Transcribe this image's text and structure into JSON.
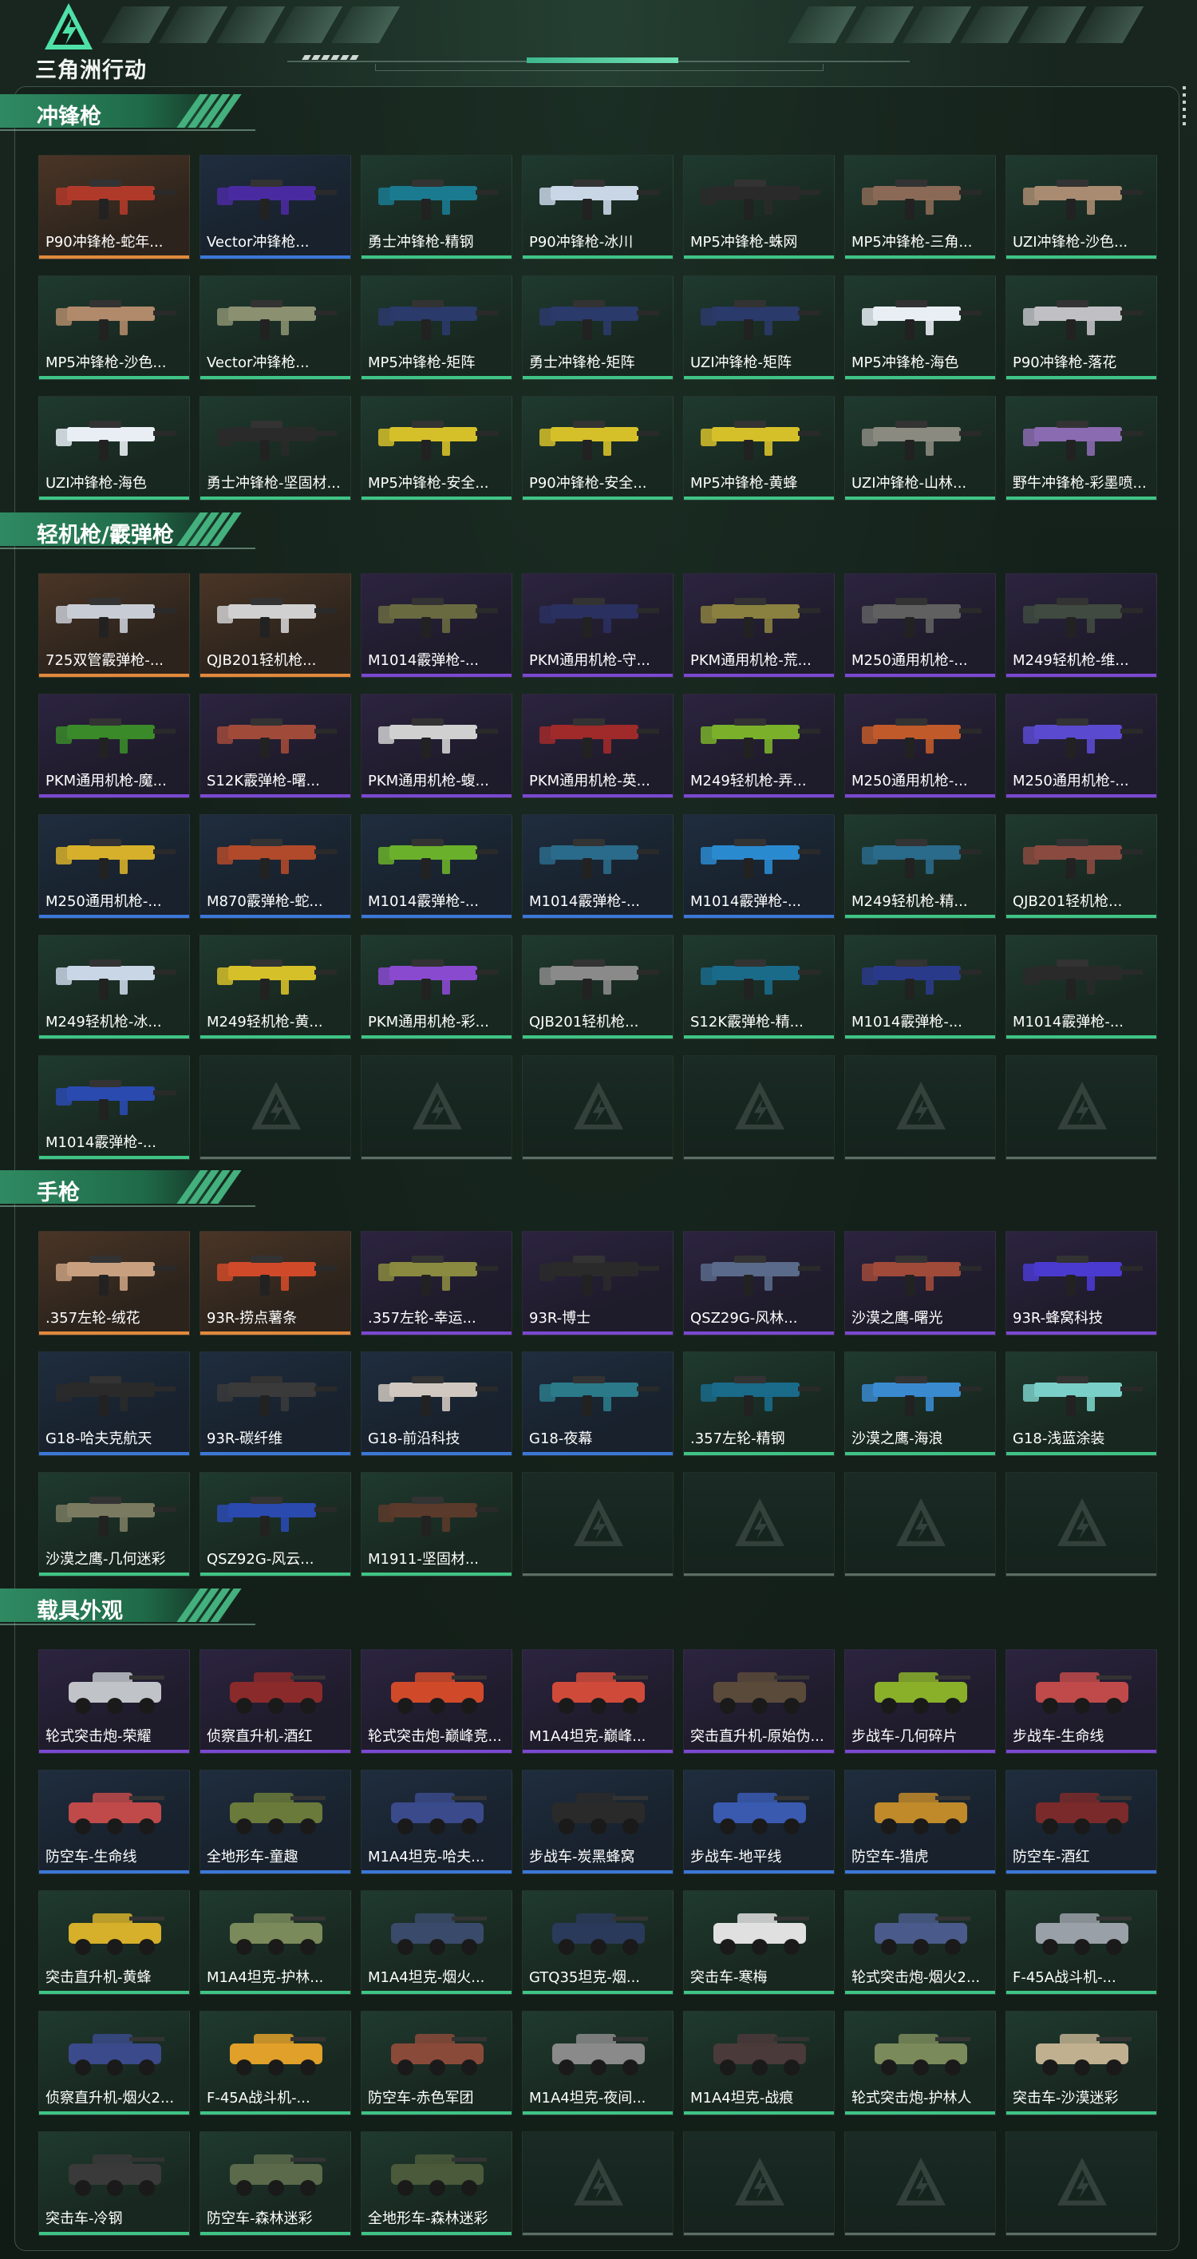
{
  "header": {
    "logo_text": "三角洲行动",
    "brand_color": "#3fc486"
  },
  "icons": {
    "logo": "delta-triangle-logo-icon",
    "item_art": "item-image-icon",
    "empty_slot": "empty-slot-icon"
  },
  "rarity_colors": {
    "gold": "#e08a3c",
    "purple": "#7a49d0",
    "blue": "#3b78d6",
    "green": "#3fc486"
  },
  "sections": [
    {
      "title": "冲锋枪",
      "items": [
        {
          "label": "P90冲锋枪-蛇年...",
          "rarity": "gold",
          "color": "#b03a2a"
        },
        {
          "label": "Vector冲锋枪...",
          "rarity": "blue",
          "color": "#4a2aa0"
        },
        {
          "label": "勇士冲锋枪-精钢",
          "rarity": "green",
          "color": "#1a7a90"
        },
        {
          "label": "P90冲锋枪-冰川",
          "rarity": "green",
          "color": "#c9d6e6"
        },
        {
          "label": "MP5冲锋枪-蛛网",
          "rarity": "green",
          "color": "#2a2a2a"
        },
        {
          "label": "MP5冲锋枪-三角...",
          "rarity": "green",
          "color": "#8a6a56"
        },
        {
          "label": "UZI冲锋枪-沙色...",
          "rarity": "green",
          "color": "#a88b70"
        },
        {
          "label": "MP5冲锋枪-沙色...",
          "rarity": "green",
          "color": "#b08a6a"
        },
        {
          "label": "Vector冲锋枪...",
          "rarity": "green",
          "color": "#8a9070"
        },
        {
          "label": "MP5冲锋枪-矩阵",
          "rarity": "green",
          "color": "#2a3a6a"
        },
        {
          "label": "勇士冲锋枪-矩阵",
          "rarity": "green",
          "color": "#2a3a6a"
        },
        {
          "label": "UZI冲锋枪-矩阵",
          "rarity": "green",
          "color": "#2a3a6a"
        },
        {
          "label": "MP5冲锋枪-海色",
          "rarity": "green",
          "color": "#e8eef4"
        },
        {
          "label": "P90冲锋枪-落花",
          "rarity": "green",
          "color": "#c0c0c4"
        },
        {
          "label": "UZI冲锋枪-海色",
          "rarity": "green",
          "color": "#e8eef4"
        },
        {
          "label": "勇士冲锋枪-坚固材...",
          "rarity": "green",
          "color": "#2a2a2a"
        },
        {
          "label": "MP5冲锋枪-安全...",
          "rarity": "green",
          "color": "#d6c02a"
        },
        {
          "label": "P90冲锋枪-安全...",
          "rarity": "green",
          "color": "#d6c02a"
        },
        {
          "label": "MP5冲锋枪-黄蜂",
          "rarity": "green",
          "color": "#d6c02a"
        },
        {
          "label": "UZI冲锋枪-山林...",
          "rarity": "green",
          "color": "#8a8a80"
        },
        {
          "label": "野牛冲锋枪-彩墨喷...",
          "rarity": "green",
          "color": "#8a6ab0"
        }
      ],
      "empty_slots": 0
    },
    {
      "title": "轻机枪/霰弹枪",
      "items": [
        {
          "label": "725双管霰弹枪-...",
          "rarity": "gold",
          "color": "#c8ccd4"
        },
        {
          "label": "QJB201轻机枪...",
          "rarity": "gold",
          "color": "#d0d0d0"
        },
        {
          "label": "M1014霰弹枪-...",
          "rarity": "purple",
          "color": "#6a6a40"
        },
        {
          "label": "PKM通用机枪-守...",
          "rarity": "purple",
          "color": "#2a3060"
        },
        {
          "label": "PKM通用机枪-荒...",
          "rarity": "purple",
          "color": "#8a8040"
        },
        {
          "label": "M250通用机枪-...",
          "rarity": "purple",
          "color": "#606060"
        },
        {
          "label": "M249轻机枪-维...",
          "rarity": "purple",
          "color": "#404a40"
        },
        {
          "label": "PKM通用机枪-魔...",
          "rarity": "purple",
          "color": "#3a8a2a"
        },
        {
          "label": "S12K霰弹枪-曙...",
          "rarity": "purple",
          "color": "#a04a3a"
        },
        {
          "label": "PKM通用机枪-蝮...",
          "rarity": "purple",
          "color": "#d0d0d0"
        },
        {
          "label": "PKM通用机枪-英...",
          "rarity": "purple",
          "color": "#a02a2a"
        },
        {
          "label": "M249轻机枪-弄...",
          "rarity": "purple",
          "color": "#7ab02a"
        },
        {
          "label": "M250通用机枪-...",
          "rarity": "purple",
          "color": "#c05a2a"
        },
        {
          "label": "M250通用机枪-...",
          "rarity": "purple",
          "color": "#5a4ad0"
        },
        {
          "label": "M250通用机枪-...",
          "rarity": "blue",
          "color": "#d6b02a"
        },
        {
          "label": "M870霰弹枪-蛇...",
          "rarity": "blue",
          "color": "#b04a2a"
        },
        {
          "label": "M1014霰弹枪-...",
          "rarity": "blue",
          "color": "#6ab02a"
        },
        {
          "label": "M1014霰弹枪-...",
          "rarity": "blue",
          "color": "#2a6a8a"
        },
        {
          "label": "M1014霰弹枪-...",
          "rarity": "blue",
          "color": "#2a8ad0"
        },
        {
          "label": "M249轻机枪-精...",
          "rarity": "green",
          "color": "#2a6a8a"
        },
        {
          "label": "QJB201轻机枪...",
          "rarity": "green",
          "color": "#8a4a40"
        },
        {
          "label": "M249轻机枪-冰...",
          "rarity": "green",
          "color": "#c9d6e6"
        },
        {
          "label": "M249轻机枪-黄...",
          "rarity": "green",
          "color": "#d6c02a"
        },
        {
          "label": "PKM通用机枪-彩...",
          "rarity": "green",
          "color": "#8a4ad0"
        },
        {
          "label": "QJB201轻机枪...",
          "rarity": "green",
          "color": "#8a8a8a"
        },
        {
          "label": "S12K霰弹枪-精...",
          "rarity": "green",
          "color": "#1a6a8a"
        },
        {
          "label": "M1014霰弹枪-...",
          "rarity": "green",
          "color": "#2a3a8a"
        },
        {
          "label": "M1014霰弹枪-...",
          "rarity": "green",
          "color": "#2a2a2a"
        },
        {
          "label": "M1014霰弹枪-...",
          "rarity": "green",
          "color": "#2a4ab0"
        }
      ],
      "empty_slots": 6
    },
    {
      "title": "手枪",
      "items": [
        {
          "label": ".357左轮-绒花",
          "rarity": "gold",
          "color": "#c8a080"
        },
        {
          "label": "93R-捞点薯条",
          "rarity": "gold",
          "color": "#d04a2a"
        },
        {
          "label": ".357左轮-幸运...",
          "rarity": "purple",
          "color": "#8a8a40"
        },
        {
          "label": "93R-博士",
          "rarity": "purple",
          "color": "#2a2a2a"
        },
        {
          "label": "QSZ29G-风林...",
          "rarity": "purple",
          "color": "#5a6a8a"
        },
        {
          "label": "沙漠之鹰-曙光",
          "rarity": "purple",
          "color": "#a04a3a"
        },
        {
          "label": "93R-蜂窝科技",
          "rarity": "purple",
          "color": "#4a3ad0"
        },
        {
          "label": "G18-哈夫克航天",
          "rarity": "blue",
          "color": "#2a2a2a"
        },
        {
          "label": "93R-碳纤维",
          "rarity": "blue",
          "color": "#3a3a3a"
        },
        {
          "label": "G18-前沿科技",
          "rarity": "blue",
          "color": "#d0c8c0"
        },
        {
          "label": "G18-夜幕",
          "rarity": "blue",
          "color": "#2a7a8a"
        },
        {
          "label": ".357左轮-精钢",
          "rarity": "green",
          "color": "#1a6a8a"
        },
        {
          "label": "沙漠之鹰-海浪",
          "rarity": "green",
          "color": "#3a8ad0"
        },
        {
          "label": "G18-浅蓝涂装",
          "rarity": "green",
          "color": "#7ad0c8"
        },
        {
          "label": "沙漠之鹰-几何迷彩",
          "rarity": "green",
          "color": "#7a7a60"
        },
        {
          "label": "QSZ92G-风云...",
          "rarity": "green",
          "color": "#2a4ab0"
        },
        {
          "label": "M1911-坚固材...",
          "rarity": "green",
          "color": "#5a3a2a"
        }
      ],
      "empty_slots": 4
    },
    {
      "title": "载具外观",
      "items": [
        {
          "label": "轮式突击炮-荣耀",
          "rarity": "purple",
          "color": "#c0c4c8"
        },
        {
          "label": "侦察直升机-酒红",
          "rarity": "purple",
          "color": "#8a2a2a"
        },
        {
          "label": "轮式突击炮-巅峰竞...",
          "rarity": "purple",
          "color": "#d04a2a"
        },
        {
          "label": "M1A4坦克-巅峰...",
          "rarity": "purple",
          "color": "#d04a3a"
        },
        {
          "label": "突击直升机-原始伪...",
          "rarity": "purple",
          "color": "#5a4a3a"
        },
        {
          "label": "步战车-几何碎片",
          "rarity": "purple",
          "color": "#8ab02a"
        },
        {
          "label": "步战车-生命线",
          "rarity": "purple",
          "color": "#c04a4a"
        },
        {
          "label": "防空车-生命线",
          "rarity": "blue",
          "color": "#c04a4a"
        },
        {
          "label": "全地形车-童趣",
          "rarity": "blue",
          "color": "#6a7a3a"
        },
        {
          "label": "M1A4坦克-哈夫...",
          "rarity": "blue",
          "color": "#3a4a8a"
        },
        {
          "label": "步战车-炭黑蜂窝",
          "rarity": "blue",
          "color": "#2a2a2a"
        },
        {
          "label": "步战车-地平线",
          "rarity": "blue",
          "color": "#3a5ab0"
        },
        {
          "label": "防空车-猎虎",
          "rarity": "blue",
          "color": "#c08a2a"
        },
        {
          "label": "防空车-酒红",
          "rarity": "blue",
          "color": "#7a2a2a"
        },
        {
          "label": "突击直升机-黄蜂",
          "rarity": "green",
          "color": "#d6b02a"
        },
        {
          "label": "M1A4坦克-护林...",
          "rarity": "green",
          "color": "#7a8a5a"
        },
        {
          "label": "M1A4坦克-烟火...",
          "rarity": "green",
          "color": "#3a4a6a"
        },
        {
          "label": "GTQ35坦克-烟...",
          "rarity": "green",
          "color": "#2a3a5a"
        },
        {
          "label": "突击车-寒梅",
          "rarity": "green",
          "color": "#e0e0e0"
        },
        {
          "label": "轮式突击炮-烟火2...",
          "rarity": "green",
          "color": "#4a5a8a"
        },
        {
          "label": "F-45A战斗机-...",
          "rarity": "green",
          "color": "#9aa0a8"
        },
        {
          "label": "侦察直升机-烟火2...",
          "rarity": "green",
          "color": "#3a4a8a"
        },
        {
          "label": "F-45A战斗机-...",
          "rarity": "green",
          "color": "#e0a02a"
        },
        {
          "label": "防空车-赤色军团",
          "rarity": "green",
          "color": "#8a4a3a"
        },
        {
          "label": "M1A4坦克-夜间...",
          "rarity": "green",
          "color": "#8a8a8a"
        },
        {
          "label": "M1A4坦克-战痕",
          "rarity": "green",
          "color": "#4a3a3a"
        },
        {
          "label": "轮式突击炮-护林人",
          "rarity": "green",
          "color": "#7a8a5a"
        },
        {
          "label": "突击车-沙漠迷彩",
          "rarity": "green",
          "color": "#c0b090"
        },
        {
          "label": "突击车-冷钢",
          "rarity": "green",
          "color": "#3a3a3a"
        },
        {
          "label": "防空车-森林迷彩",
          "rarity": "green",
          "color": "#5a6a4a"
        },
        {
          "label": "全地形车-森林迷彩",
          "rarity": "green",
          "color": "#4a5a3a"
        }
      ],
      "empty_slots": 4
    }
  ]
}
